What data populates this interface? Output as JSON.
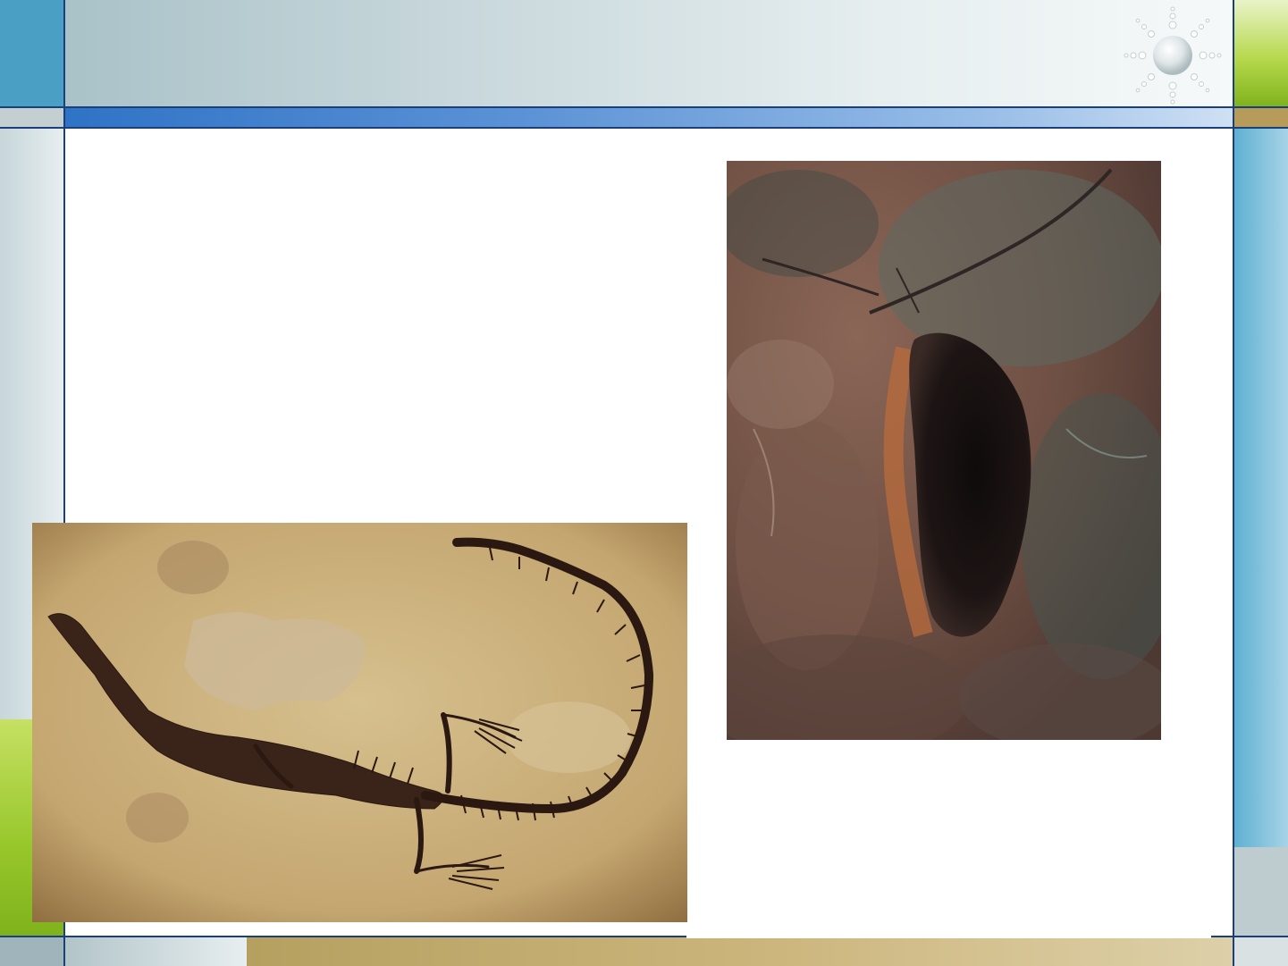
{
  "slide": {
    "theme": {
      "header_gradient_start": "#a9c2c8",
      "header_gradient_end": "#f6f9f9",
      "accent_stripe_blue": "#2f73c6",
      "accent_green": "#7fb21c",
      "accent_gold": "#b79b5a",
      "side_blue": "#5fb0d2",
      "frame_line": "#1b3f7a"
    },
    "logo": {
      "icon": "sun-icon"
    },
    "pictures": [
      {
        "name": "reptile-fossil-photo",
        "subject": "fossil-skeleton-in-rock"
      },
      {
        "name": "footprint-fossil-photo",
        "subject": "footprint-impression-in-rock"
      }
    ]
  }
}
